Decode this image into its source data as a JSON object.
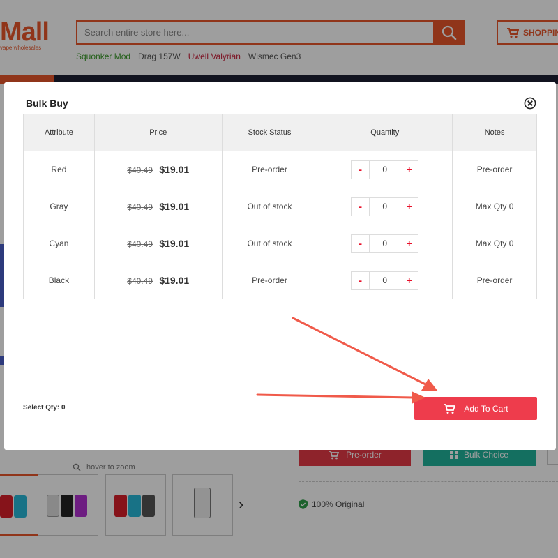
{
  "header": {
    "logo_text": "Mall",
    "logo_subtext": "vape wholesales",
    "search_placeholder": "Search entire store here...",
    "shopping_label": "SHOPPIN"
  },
  "hotwords": [
    "Squonker Mod",
    "Drag 157W",
    "Uwell Valyrian",
    "Wismec Gen3"
  ],
  "background": {
    "preorder_label": "Pre-order",
    "bulk_choice_label": "Bulk Choice",
    "hover_zoom": "hover to zoom",
    "original_label": "100% Original"
  },
  "modal": {
    "title": "Bulk Buy",
    "columns": [
      "Attribute",
      "Price",
      "Stock Status",
      "Quantity",
      "Notes"
    ],
    "rows": [
      {
        "attribute": "Red",
        "old_price": "$40.49",
        "price": "$19.01",
        "stock": "Pre-order",
        "qty": "0",
        "notes": "Pre-order"
      },
      {
        "attribute": "Gray",
        "old_price": "$40.49",
        "price": "$19.01",
        "stock": "Out of stock",
        "qty": "0",
        "notes": "Max Qty 0"
      },
      {
        "attribute": "Cyan",
        "old_price": "$40.49",
        "price": "$19.01",
        "stock": "Out of stock",
        "qty": "0",
        "notes": "Max Qty 0"
      },
      {
        "attribute": "Black",
        "old_price": "$40.49",
        "price": "$19.01",
        "stock": "Pre-order",
        "qty": "0",
        "notes": "Pre-order"
      }
    ],
    "minus_label": "-",
    "plus_label": "+",
    "select_qty": "Select Qty: 0",
    "add_to_cart_label": "Add To Cart"
  },
  "colors": {
    "brand_orange": "#e8562a",
    "add_cart_red": "#ee3c4c",
    "qty_red": "#e8102a",
    "bulk_teal": "#21b39b",
    "annotation_arrow": "#f05a4a"
  }
}
